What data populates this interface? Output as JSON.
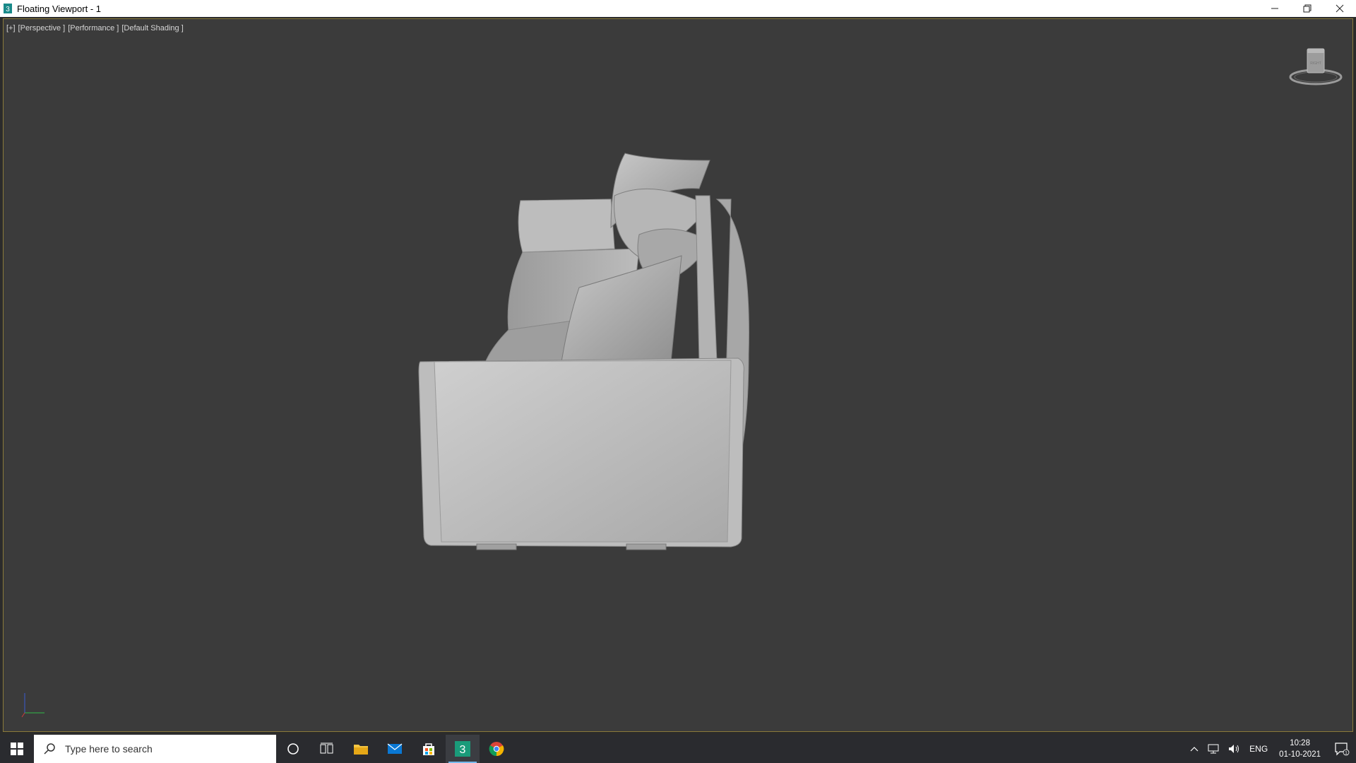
{
  "window": {
    "title": "Floating Viewport - 1",
    "minimize_symbol": "─",
    "restore_symbol": "❐",
    "close_symbol": "✕"
  },
  "viewport": {
    "labels": [
      "[+]",
      "[Perspective ]",
      "[Performance ]",
      "[Default Shading ]"
    ],
    "viewcube_face": "RIGHT",
    "bg_color": "#3b3b3b"
  },
  "taskbar": {
    "search_placeholder": "Type here to search",
    "apps": [
      {
        "name": "cortana-icon"
      },
      {
        "name": "task-view-icon"
      },
      {
        "name": "file-explorer-icon"
      },
      {
        "name": "mail-icon"
      },
      {
        "name": "store-icon"
      },
      {
        "name": "3ds-max-icon",
        "label": "3",
        "active": true
      },
      {
        "name": "chrome-icon"
      }
    ],
    "tray": {
      "language": "ENG",
      "time": "10:28",
      "date": "01-10-2021",
      "notification_count": "1"
    }
  }
}
